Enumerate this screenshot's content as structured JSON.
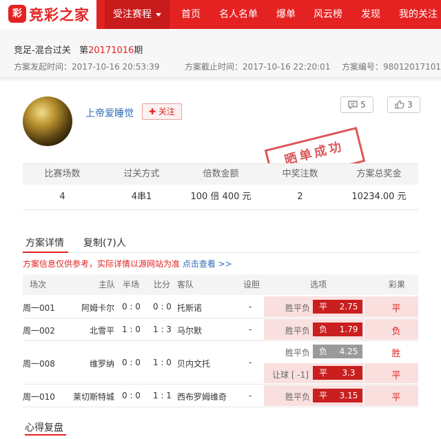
{
  "header": {
    "logo_text": "竞彩之家",
    "nav": [
      "受注赛程",
      "首页",
      "名人名单",
      "爆单",
      "风云榜",
      "发现",
      "我的关注"
    ],
    "brand_color": "#e52222"
  },
  "plan": {
    "title_prefix": "竞足-混合过关",
    "issue_prefix": "第",
    "issue_number": "20171016",
    "issue_suffix": "期",
    "start_time": "方案发起时间：2017-10-16 20:53:39",
    "end_time": "方案截止时间：2017-10-16 22:20:01",
    "plan_id": "方案编号：980120171016"
  },
  "user": {
    "name": "上帝爱睡觉",
    "follow_label": "关注",
    "comments": "5",
    "likes": "3",
    "stamp": "晒单成功"
  },
  "summary": {
    "headers": [
      "比赛场数",
      "过关方式",
      "倍数金额",
      "中奖注数",
      "方案总奖金"
    ],
    "values": [
      "4",
      "4串1",
      "100 倍  400 元",
      "2",
      "10234.00 元"
    ]
  },
  "tabs": [
    "方案详情",
    "复制(7)人"
  ],
  "notice": {
    "text": "方案信息仅供参考，实际详情以源网站为准",
    "link": "点击查看 >>"
  },
  "matches": {
    "headers": [
      "场次",
      "主队",
      "半场",
      "比分",
      "客队",
      "设胆",
      "选项",
      "彩果"
    ],
    "rows": [
      {
        "no": "周一001",
        "home": "阿姆卡尔",
        "half": "0 : 0",
        "score": "0 : 0",
        "away": "托斯诺",
        "banker": "-",
        "options": [
          {
            "label": "胜平负",
            "pick": "平",
            "odds": "2.75",
            "hit": true,
            "result": "平"
          }
        ]
      },
      {
        "no": "周一002",
        "home": "北雪平",
        "half": "1 : 0",
        "score": "1 : 3",
        "away": "马尔默",
        "banker": "-",
        "options": [
          {
            "label": "胜平负",
            "pick": "负",
            "odds": "1.79",
            "hit": true,
            "result": "负"
          }
        ]
      },
      {
        "no": "周一008",
        "home": "维罗纳",
        "half": "0 : 0",
        "score": "1 : 0",
        "away": "贝内文托",
        "banker": "-",
        "options": [
          {
            "label": "胜平负",
            "pick": "负",
            "odds": "4.25",
            "hit": false,
            "result": "胜"
          },
          {
            "label": "让球 [ -1]",
            "pick": "平",
            "odds": "3.3",
            "hit": true,
            "result": "平"
          }
        ]
      },
      {
        "no": "周一010",
        "home": "莱切斯特城",
        "half": "0 : 0",
        "score": "1 : 1",
        "away": "西布罗姆维奇",
        "banker": "-",
        "options": [
          {
            "label": "胜平负",
            "pick": "平",
            "odds": "3.15",
            "hit": true,
            "result": "平"
          }
        ]
      }
    ]
  },
  "section2_title": "心得复盘"
}
